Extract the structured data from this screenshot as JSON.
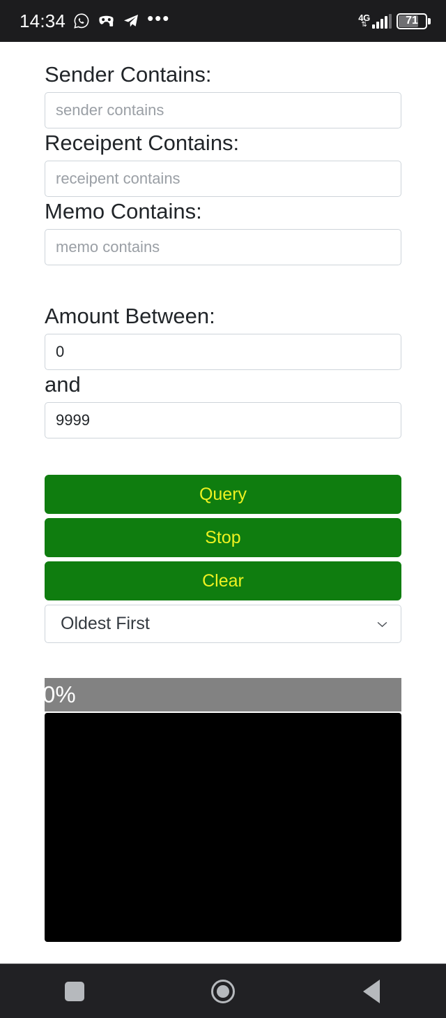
{
  "statusbar": {
    "time": "14:34",
    "icons": [
      "whatsapp-icon",
      "game-mask-icon",
      "telegram-icon",
      "more-icon"
    ],
    "more": "•••",
    "network_type": "4G",
    "network_arrows": "⇅",
    "signal_bars": 4,
    "battery_level": "71"
  },
  "form": {
    "sender": {
      "label": "Sender Contains:",
      "placeholder": "sender contains",
      "value": ""
    },
    "recipient": {
      "label": "Receipent Contains:",
      "placeholder": "receipent contains",
      "value": ""
    },
    "memo": {
      "label": "Memo Contains:",
      "placeholder": "memo contains",
      "value": ""
    },
    "amount": {
      "label": "Amount Between:",
      "and_label": "and",
      "min_value": "0",
      "max_value": "9999",
      "min_placeholder": "0",
      "max_placeholder": "9999"
    }
  },
  "buttons": {
    "query": "Query",
    "stop": "Stop",
    "clear": "Clear"
  },
  "sort": {
    "selected": "Oldest First",
    "icon": "chevron-down-icon"
  },
  "progress": {
    "percent_label": "0%",
    "percent_value": 0,
    "bar_color": "#828282",
    "text_color": "#ffffff"
  },
  "console": {
    "text": "",
    "background": "#000000"
  },
  "colors": {
    "button_green": "#0f7d0f",
    "button_yellow": "#edf221",
    "input_border": "#ced4da",
    "label_text": "#212529",
    "statusbar_bg": "#1c1c1e",
    "navbar_bg": "#212124"
  },
  "navbar": {
    "recents": "recents-square-icon",
    "home": "home-circle-icon",
    "back": "back-triangle-icon"
  }
}
